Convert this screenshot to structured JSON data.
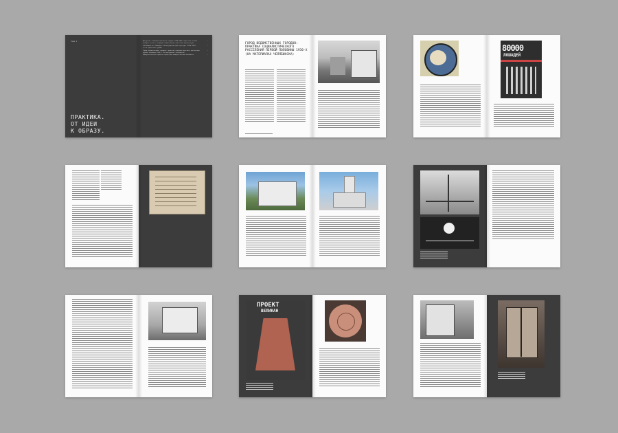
{
  "spread1": {
    "toc_label": "Тема 4",
    "toc": [
      {
        "title": "Дискуссия «Социалистического города» 1929–1930 годов как основа",
        "page": "—"
      },
      {
        "title": "возврат этого к созданию новой модели советской архитектуры",
        "page": ""
      },
      {
        "title": "«Всеобщность» Пишберна: Ленинградский Дом культуры (1930–1933)",
        "page": "—"
      },
      {
        "title": "и его проектная судьба",
        "page": ""
      },
      {
        "title": "Город ведомственных городов: практика социалистического расселения",
        "page": "—"
      },
      {
        "title": "первой половины 1930-х (на материалах Челябинска)",
        "page": ""
      },
      {
        "title": "Коммунистические проекты одной Дом-коммуна Москва—Челябинск",
        "page": "—"
      }
    ],
    "title": "ПРАКТИКА.\nОТ ИДЕИ\nК ОБРАЗУ."
  },
  "spread2": {
    "title": "ГОРОД ВЕДОМСТВЕННЫХ ГОРОДОВ: ПРАКТИКА СОЦИАЛИСТИЧЕСКОГО РАССЕЛЕНИЯ ПЕРВОЙ ПОЛОВИНЫ 1930-Х (НА МАТЕРИАЛАХ ЧЕЛЯБИНСКА)"
  },
  "spread6": {
    "poster_head": "ПРОЕКТ",
    "poster_sub": "ВЕЛИКАН"
  },
  "spread3": {
    "poster_number": "80000",
    "poster_line": "ЛОШАДЕЙ"
  }
}
